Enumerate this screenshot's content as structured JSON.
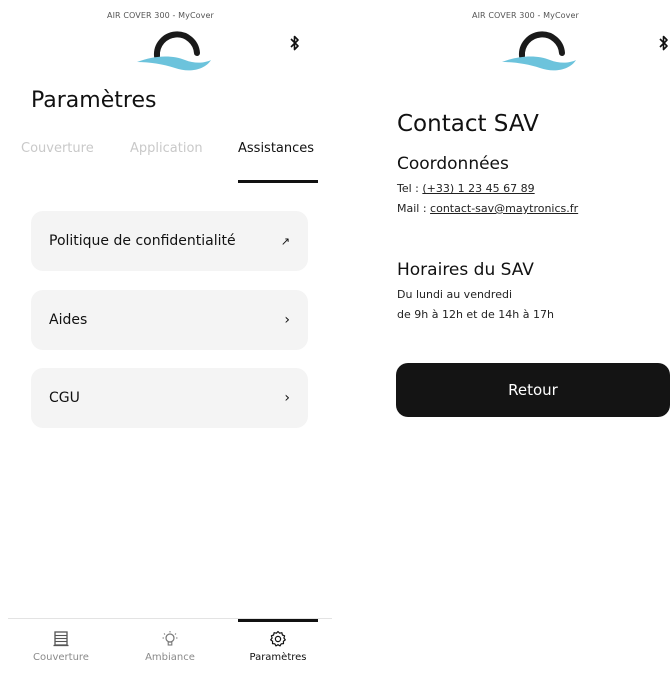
{
  "colors": {
    "logo_dark": "#1a1a1a",
    "logo_wave": "#6cc3dc",
    "card_bg": "#f4f4f4",
    "button_bg": "#141414",
    "inactive_text": "#c9c9c9"
  },
  "left_screen": {
    "app_name": "AIR COVER 300 - MyCover",
    "bluetooth_icon": "bluetooth-icon",
    "title": "Paramètres",
    "tabs": [
      {
        "label": "Couverture",
        "active": false
      },
      {
        "label": "Application",
        "active": false
      },
      {
        "label": "Assistances",
        "active": true
      }
    ],
    "menu": [
      {
        "label": "Politique de confidentialité",
        "icon": "external-arrow-icon"
      },
      {
        "label": "Aides",
        "icon": "chevron-right-icon"
      },
      {
        "label": "CGU",
        "icon": "chevron-right-icon"
      }
    ],
    "bottom_nav": [
      {
        "label": "Couverture",
        "icon": "cover-icon",
        "active": false
      },
      {
        "label": "Ambiance",
        "icon": "lightbulb-icon",
        "active": false
      },
      {
        "label": "Paramètres",
        "icon": "gear-icon",
        "active": true
      }
    ]
  },
  "right_screen": {
    "app_name": "AIR COVER 300 - MyCover",
    "bluetooth_icon": "bluetooth-icon",
    "title": "Contact SAV",
    "coordinates": {
      "heading": "Coordonnées",
      "tel_label": "Tel : ",
      "tel_value": "(+33) 1 23 45 67 89",
      "mail_label": "Mail : ",
      "mail_value": "contact-sav@maytronics.fr"
    },
    "hours": {
      "heading": "Horaires du SAV",
      "line1": "Du lundi au vendredi",
      "line2": "de 9h à 12h et de 14h à 17h"
    },
    "back_label": "Retour"
  }
}
